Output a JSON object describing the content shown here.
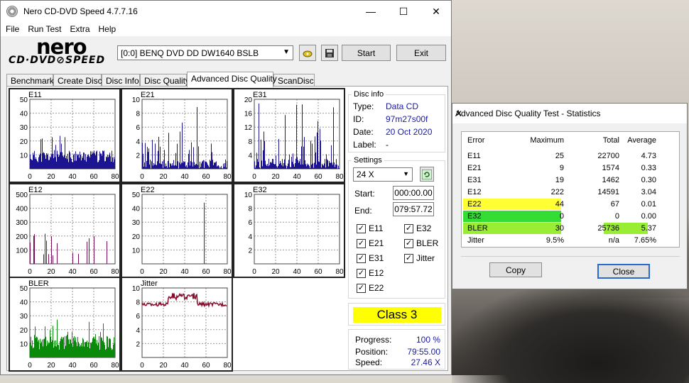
{
  "window": {
    "title": "Nero CD-DVD Speed 4.7.7.16",
    "minimize": "—",
    "maximize": "☐",
    "close": "✕"
  },
  "menu": [
    "File",
    "Run Test",
    "Extra",
    "Help"
  ],
  "logo": {
    "top": "nero",
    "bottom": "CD·DVD⊘SPEED"
  },
  "toolbar": {
    "drive": "[0:0]  BENQ DVD DD DW1640 BSLB",
    "start": "Start",
    "exit": "Exit"
  },
  "tabs": [
    "Benchmark",
    "Create Disc",
    "Disc Info",
    "Disc Quality",
    "Advanced Disc Quality",
    "ScanDisc"
  ],
  "active_tab": "Advanced Disc Quality",
  "disc_info": {
    "title": "Disc info",
    "type_label": "Type:",
    "type": "Data CD",
    "id_label": "ID:",
    "id": "97m27s00f",
    "date_label": "Date:",
    "date": "20 Oct 2020",
    "label_label": "Label:",
    "label": "-"
  },
  "settings": {
    "title": "Settings",
    "speed": "24 X",
    "start_label": "Start:",
    "start": "000:00.00",
    "end_label": "End:",
    "end": "079:57.72"
  },
  "checkboxes": {
    "e11": "E11",
    "e32": "E32",
    "e21": "E21",
    "bler": "BLER",
    "e31": "E31",
    "jitter": "Jitter",
    "e12": "E12",
    "e22": "E22"
  },
  "class_badge": "Class 3",
  "progress": {
    "progress_label": "Progress:",
    "progress": "100 %",
    "position_label": "Position:",
    "position": "79:55.00",
    "speed_label": "Speed:",
    "speed": "27.46 X"
  },
  "colors": {
    "navy": "#1c1490",
    "maroon": "#7a0a3a",
    "green": "#0a8a0a",
    "yellow": "#ffff00",
    "lime": "#33ee33"
  },
  "chart_data": [
    {
      "type": "bar",
      "title": "E11",
      "ylim": [
        0,
        50
      ],
      "yticks": [
        "50",
        "40",
        "30",
        "20",
        "10"
      ],
      "xticks": [
        "0",
        "20",
        "40",
        "60",
        "80"
      ],
      "color": "#1c1490",
      "peak": 25
    },
    {
      "type": "bar",
      "title": "E21",
      "ylim": [
        0,
        10
      ],
      "yticks": [
        "10",
        "8",
        "6",
        "4",
        "2"
      ],
      "xticks": [
        "0",
        "20",
        "40",
        "60",
        "80"
      ],
      "color": "#1c1490",
      "peak": 9
    },
    {
      "type": "bar",
      "title": "E31",
      "ylim": [
        0,
        20
      ],
      "yticks": [
        "20",
        "16",
        "12",
        "8",
        "4"
      ],
      "xticks": [
        "0",
        "20",
        "40",
        "60",
        "80"
      ],
      "color": "#1c1490",
      "peak": 19
    },
    {
      "type": "bar",
      "title": "E12",
      "ylim": [
        0,
        500
      ],
      "yticks": [
        "500",
        "400",
        "300",
        "200",
        "100"
      ],
      "xticks": [
        "0",
        "20",
        "40",
        "60",
        "80"
      ],
      "color": "#7a0a5a",
      "peak": 222
    },
    {
      "type": "bar",
      "title": "E22",
      "ylim": [
        0,
        50
      ],
      "yticks": [
        "50",
        "40",
        "30",
        "20",
        "10"
      ],
      "xticks": [
        "0",
        "20",
        "40",
        "60",
        "80"
      ],
      "color": "#7a0a5a",
      "peak": 44
    },
    {
      "type": "bar",
      "title": "E32",
      "ylim": [
        0,
        10
      ],
      "yticks": [
        "10",
        "8",
        "6",
        "4",
        "2"
      ],
      "xticks": [
        "0",
        "20",
        "40",
        "60",
        "80"
      ],
      "color": "#7a0a5a",
      "peak": 0
    },
    {
      "type": "bar",
      "title": "BLER",
      "ylim": [
        0,
        50
      ],
      "yticks": [
        "50",
        "40",
        "30",
        "20",
        "10"
      ],
      "xticks": [
        "0",
        "20",
        "40",
        "60",
        "80"
      ],
      "color": "#0a8a0a",
      "peak": 30
    },
    {
      "type": "line",
      "title": "Jitter",
      "ylim": [
        0,
        10
      ],
      "yticks": [
        "10",
        "8",
        "6",
        "4",
        "2"
      ],
      "xticks": [
        "0",
        "20",
        "40",
        "60",
        "80"
      ],
      "color": "#8a0a2a",
      "peak": 9.5
    }
  ],
  "dialog": {
    "title": "Advanced Disc Quality Test - Statistics",
    "close": "✕",
    "headers": [
      "Error",
      "Maximum",
      "Total",
      "Average"
    ],
    "rows": [
      [
        "E11",
        "25",
        "22700",
        "4.73"
      ],
      [
        "E21",
        "9",
        "1574",
        "0.33"
      ],
      [
        "E31",
        "19",
        "1462",
        "0.30"
      ],
      [
        "E12",
        "222",
        "14591",
        "3.04"
      ],
      [
        "E22",
        "44",
        "67",
        "0.01"
      ],
      [
        "E32",
        "0",
        "0",
        "0.00"
      ],
      [
        "BLER",
        "30",
        "25736",
        "5.37"
      ],
      [
        "Jitter",
        "9.5%",
        "n/a",
        "7.65%"
      ]
    ],
    "copy": "Copy",
    "close_btn": "Close"
  }
}
